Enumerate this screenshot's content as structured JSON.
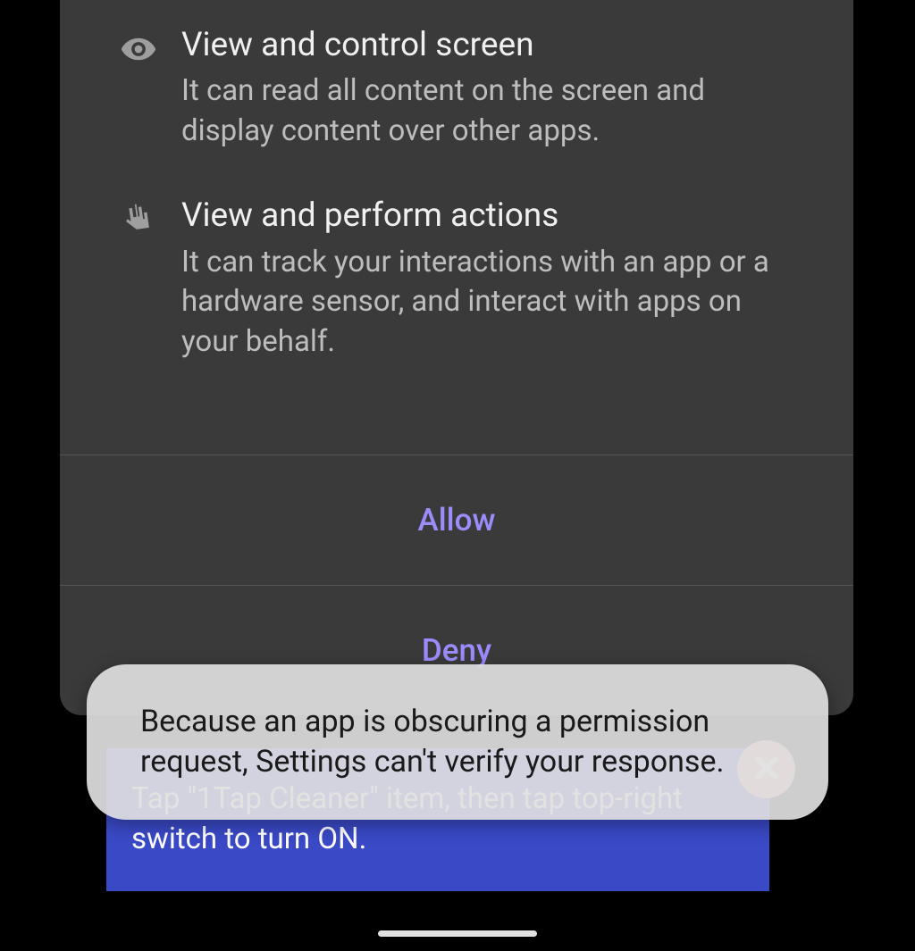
{
  "permissions": [
    {
      "icon": "eye-icon",
      "title": "View and control screen",
      "description": "It can read all content on the screen and display content over other apps."
    },
    {
      "icon": "hand-icon",
      "title": "View and perform actions",
      "description": "It can track your interactions with an app or a hardware sensor, and interact with apps on your behalf."
    }
  ],
  "buttons": {
    "allow": "Allow",
    "deny": "Deny"
  },
  "instruction": {
    "text": "Tap \"1Tap Cleaner\" item, then tap top-right switch to turn ON."
  },
  "toast": {
    "text": "Because an app is obscuring a permission request, Settings can't verify your response."
  }
}
